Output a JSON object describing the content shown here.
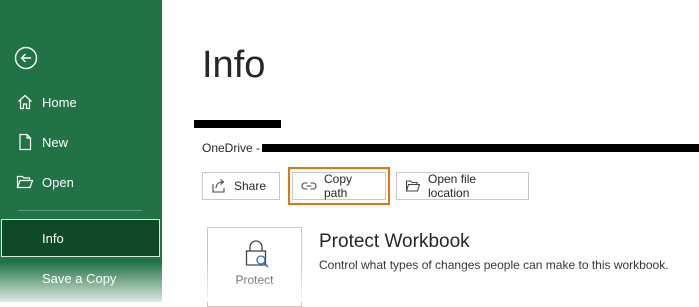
{
  "sidebar": {
    "back_icon": "back-arrow-icon",
    "items": [
      {
        "label": "Home",
        "icon": "home-icon"
      },
      {
        "label": "New",
        "icon": "new-file-icon"
      },
      {
        "label": "Open",
        "icon": "folder-open-icon"
      },
      {
        "label": "Info",
        "selected": true
      },
      {
        "label": "Save a Copy"
      }
    ],
    "background_color": "#217346",
    "selected_color": "#0e4a28"
  },
  "main": {
    "title": "Info",
    "file_name": "",
    "location_prefix": "OneDrive -",
    "actions": [
      {
        "label": "Share",
        "icon": "share-icon"
      },
      {
        "label": "Copy path",
        "icon": "link-icon",
        "highlighted": true
      },
      {
        "label": "Open file location",
        "icon": "folder-open-icon"
      }
    ],
    "protect": {
      "button_label": "Protect",
      "icon": "lock-magnifier-icon",
      "title": "Protect Workbook",
      "description": "Control what types of changes people can make to this workbook."
    },
    "highlight_color": "#e8720c"
  }
}
